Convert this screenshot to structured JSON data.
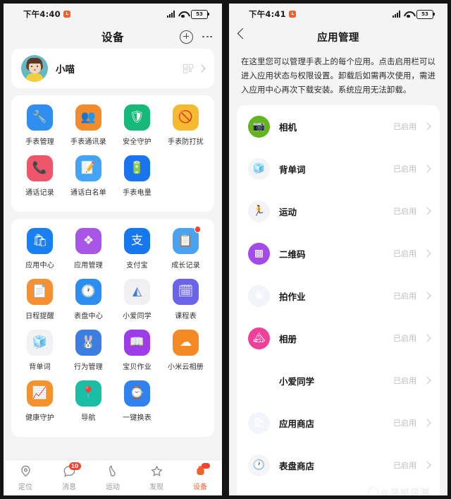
{
  "left": {
    "status": {
      "time": "下午4:40",
      "alarm_icon": "alarm-icon",
      "battery": "53"
    },
    "header": {
      "title": "设备",
      "add_icon": "plus-circle-icon",
      "more_icon": "more-dots-icon"
    },
    "profile": {
      "name": "小喵",
      "qr_icon": "qr-code-icon",
      "chevron_icon": "chevron-right-icon"
    },
    "groups": [
      {
        "id": "watch-tools",
        "items": [
          {
            "label": "手表管理",
            "glyph": "🔧",
            "bg": "#2f8ef0",
            "badge": false
          },
          {
            "label": "手表通讯录",
            "glyph": "👥",
            "bg": "#f48b2a",
            "badge": false
          },
          {
            "label": "安全守护",
            "glyph": "🛡",
            "bg": "#17b978",
            "badge": false
          },
          {
            "label": "手表防打扰",
            "glyph": "🚫",
            "bg": "#f5bb2e",
            "badge": false
          },
          {
            "label": "通话记录",
            "glyph": "📞",
            "bg": "#f0566a",
            "badge": false
          },
          {
            "label": "通话白名单",
            "glyph": "📝",
            "bg": "#43a3f5",
            "badge": false
          },
          {
            "label": "手表电量",
            "glyph": "🔋",
            "bg": "#1a73f0",
            "badge": false
          }
        ]
      },
      {
        "id": "watch-apps",
        "items": [
          {
            "label": "应用中心",
            "glyph": "🛍",
            "bg": "#1a7ff0",
            "badge": false
          },
          {
            "label": "应用管理",
            "glyph": "❖",
            "bg": "#a855e8",
            "badge": false
          },
          {
            "label": "支付宝",
            "glyph": "支",
            "bg": "#1677ef",
            "badge": false
          },
          {
            "label": "成长记录",
            "glyph": "📋",
            "bg": "#4aa3f2",
            "badge": true
          },
          {
            "label": "日程提醒",
            "glyph": "📄",
            "bg": "#f59133",
            "badge": false
          },
          {
            "label": "表盘中心",
            "glyph": "🕐",
            "bg": "#2a8ef2",
            "badge": false
          },
          {
            "label": "小爱同学",
            "glyph": "◭",
            "bg": "#f0f0f2",
            "badge": false
          },
          {
            "label": "课程表",
            "glyph": "🗓",
            "bg": "#6b64ea",
            "badge": false
          },
          {
            "label": "背单词",
            "glyph": "🧊",
            "bg": "#f2f2f4",
            "badge": false
          },
          {
            "label": "行为管理",
            "glyph": "🐰",
            "bg": "#3b7de0",
            "badge": false
          },
          {
            "label": "宝贝作业",
            "glyph": "📖",
            "bg": "#9d3ce8",
            "badge": false
          },
          {
            "label": "小米云相册",
            "glyph": "☁",
            "bg": "#f58a24",
            "badge": false
          },
          {
            "label": "健康守护",
            "glyph": "📈",
            "bg": "#f5922c",
            "badge": false
          },
          {
            "label": "导航",
            "glyph": "📍",
            "bg": "#18bfa5",
            "badge": false
          },
          {
            "label": "一键换表",
            "glyph": "⌚",
            "bg": "#2f82f0",
            "badge": false
          }
        ]
      }
    ],
    "tabs": [
      {
        "label": "定位",
        "icon": "location-pin-icon",
        "active": false,
        "badge": ""
      },
      {
        "label": "消息",
        "icon": "message-bubble-icon",
        "active": false,
        "badge": "10"
      },
      {
        "label": "运动",
        "icon": "shoe-print-icon",
        "active": false,
        "badge": ""
      },
      {
        "label": "发现",
        "icon": "star-icon",
        "active": false,
        "badge": ""
      },
      {
        "label": "设备",
        "icon": "watch-device-icon",
        "active": true,
        "badge": "dot"
      }
    ]
  },
  "right": {
    "status": {
      "time": "下午4:41",
      "alarm_icon": "alarm-icon",
      "battery": "53"
    },
    "header": {
      "title": "应用管理",
      "back_icon": "back-chevron-icon"
    },
    "description": "在这里您可以管理手表上的每个应用。点击启用栏可以进入应用状态与权限设置。卸载后如需再次使用，需进入应用中心再次下载安装。系统应用无法卸载。",
    "apps": [
      {
        "name": "相机",
        "state": "已启用",
        "glyph": "📷",
        "bg": "#62b51c",
        "chevron": "chevron-right-icon"
      },
      {
        "name": "背单词",
        "state": "已启用",
        "glyph": "🧊",
        "bg": "#f4f4f6",
        "chevron": "chevron-right-icon"
      },
      {
        "name": "运动",
        "state": "已启用",
        "glyph": "🏃",
        "bg": "#f4f4f6",
        "chevron": "chevron-right-icon"
      },
      {
        "name": "二维码",
        "state": "已启用",
        "glyph": "▩",
        "bg": "#a34ae8",
        "chevron": "chevron-right-icon"
      },
      {
        "name": "拍作业",
        "state": "已启用",
        "glyph": "◉",
        "bg": "#f2f4fc",
        "chevron": "chevron-right-icon"
      },
      {
        "name": "相册",
        "state": "已启用",
        "glyph": "🏔",
        "bg": "#f0409a",
        "chevron": "chevron-right-icon"
      },
      {
        "name": "小爱同学",
        "state": "已启用",
        "glyph": "◭",
        "bg": "#ffffff",
        "chevron": "chevron-right-icon"
      },
      {
        "name": "应用商店",
        "state": "已启用",
        "glyph": "🛍",
        "bg": "#f2f6fc",
        "chevron": "chevron-right-icon"
      },
      {
        "name": "表盘商店",
        "state": "已启用",
        "glyph": "🕐",
        "bg": "#f5f5f7",
        "chevron": "chevron-right-icon"
      }
    ],
    "watermark": "@竖锯评测"
  },
  "colors": {
    "accent": "#f0622c",
    "badge": "#f4422e",
    "page_bg": "#f4f4f4",
    "card_bg": "#ffffff"
  }
}
